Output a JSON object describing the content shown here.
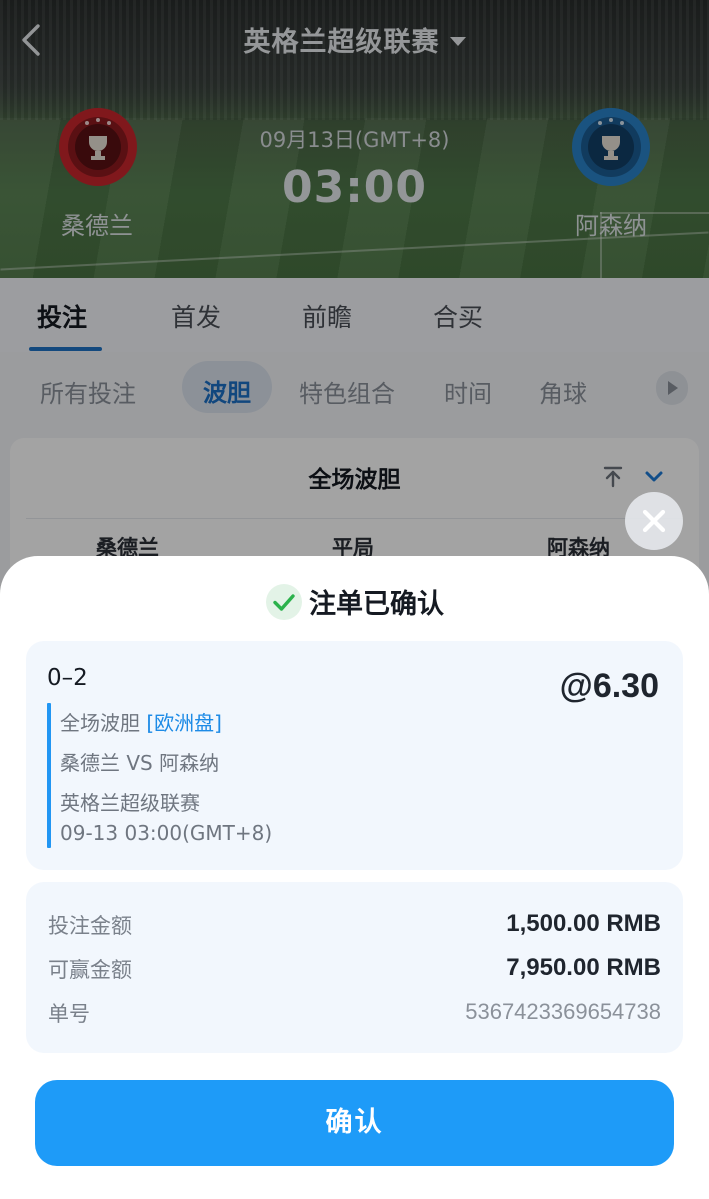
{
  "header": {
    "league_title": "英格兰超级联赛",
    "home_team": "桑德兰",
    "away_team": "阿森纳",
    "match_date": "09月13日(GMT+8)",
    "match_time": "03:00",
    "home_badge_color": "#c8272d",
    "away_badge_color": "#2a83c9"
  },
  "tabs": [
    {
      "label": "投注",
      "active": true
    },
    {
      "label": "首发",
      "active": false
    },
    {
      "label": "前瞻",
      "active": false
    },
    {
      "label": "合买",
      "active": false
    }
  ],
  "filters": [
    {
      "label": "所有投注",
      "active": false
    },
    {
      "label": "波胆",
      "active": true
    },
    {
      "label": "特色组合",
      "active": false
    },
    {
      "label": "时间",
      "active": false
    },
    {
      "label": "角球",
      "active": false
    }
  ],
  "market": {
    "title": "全场波胆",
    "columns": [
      "桑德兰",
      "平局",
      "阿森纳"
    ]
  },
  "sheet": {
    "title": "注单已确认",
    "selection": "0–2",
    "odds": "@6.30",
    "market_name": "全场波胆",
    "market_type": "[欧洲盘]",
    "match": "桑德兰 VS 阿森纳",
    "league": "英格兰超级联赛",
    "datetime": "09-13 03:00(GMT+8)",
    "stake_label": "投注金额",
    "stake_value": "1,500.00 RMB",
    "payout_label": "可赢金额",
    "payout_value": "7,950.00 RMB",
    "ref_label": "单号",
    "ref_value": "5367423369654738",
    "confirm_label": "确认"
  },
  "colors": {
    "accent": "#1e9bf8",
    "tab_accent": "#1f72c6",
    "success": "#2bb24c"
  }
}
